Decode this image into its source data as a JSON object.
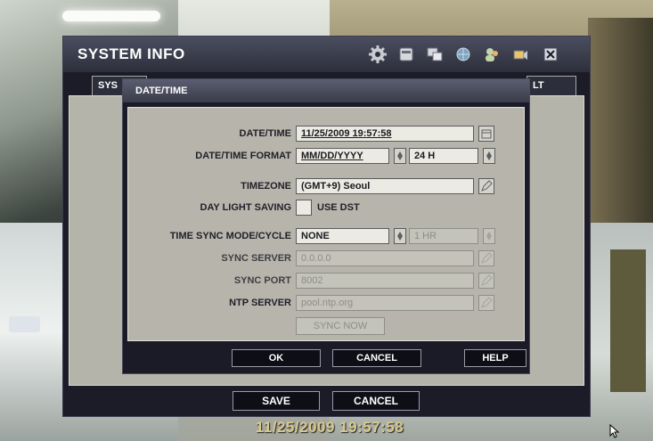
{
  "system_info": {
    "title": "SYSTEM INFO",
    "tabs": {
      "left": "SYS",
      "right": "LT"
    },
    "toolbar_icons": [
      "gear-icon",
      "hdd-icon",
      "monitor-icon",
      "network-icon",
      "user-icon",
      "camera-icon",
      "close-icon"
    ],
    "buttons": {
      "save": "SAVE",
      "cancel": "CANCEL"
    }
  },
  "dialog": {
    "title": "DATE/TIME",
    "fields": {
      "datetime": {
        "label": "DATE/TIME",
        "value": "11/25/2009 19:57:58"
      },
      "format": {
        "label": "DATE/TIME FORMAT",
        "date_value": "MM/DD/YYYY",
        "time_value": "24 H"
      },
      "timezone": {
        "label": "TIMEZONE",
        "value": "(GMT+9) Seoul"
      },
      "dst": {
        "label": "DAY LIGHT SAVING",
        "checkbox_label": "USE DST",
        "checked": false
      },
      "sync_mode": {
        "label": "TIME SYNC MODE/CYCLE",
        "value": "NONE",
        "cycle": "1 HR"
      },
      "sync_server": {
        "label": "SYNC SERVER",
        "value": "0.0.0.0"
      },
      "sync_port": {
        "label": "SYNC PORT",
        "value": "8002"
      },
      "ntp_server": {
        "label": "NTP SERVER",
        "value": "pool.ntp.org"
      }
    },
    "sync_now": "SYNC NOW",
    "buttons": {
      "ok": "OK",
      "cancel": "CANCEL",
      "help": "HELP"
    }
  },
  "overlay_clock": "11/25/2009 19:57:58",
  "colors": {
    "panel": "#b7b5ab",
    "frame": "#1a1b27",
    "clock_text": "#d9c98d"
  }
}
